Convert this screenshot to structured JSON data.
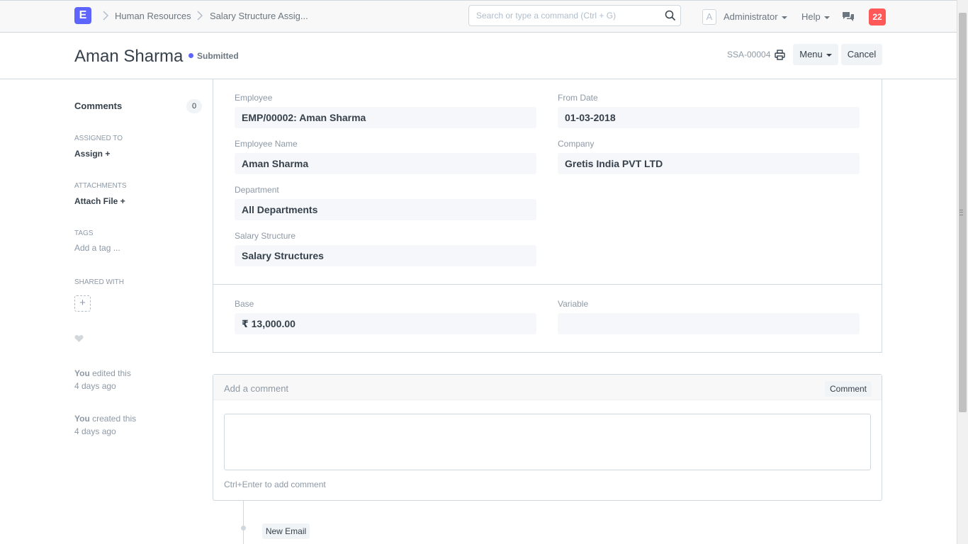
{
  "navbar": {
    "logo_letter": "E",
    "breadcrumbs": [
      "Human Resources",
      "Salary Structure Assig..."
    ],
    "search_placeholder": "Search or type a command (Ctrl + G)",
    "user_initial": "A",
    "user_label": "Administrator",
    "help_label": "Help",
    "notification_count": "22",
    "icons": [
      "chevron-right-icon",
      "search-icon",
      "caret-down-icon",
      "chat-icon"
    ]
  },
  "page": {
    "title": "Aman Sharma",
    "status": "Submitted",
    "status_color": "#5e64ff",
    "doc_id": "SSA-00004",
    "menu_label": "Menu",
    "cancel_label": "Cancel"
  },
  "sidebar": {
    "comments_label": "Comments",
    "comments_count": "0",
    "assigned_to_label": "ASSIGNED TO",
    "assign_label": "Assign",
    "attachments_label": "ATTACHMENTS",
    "attach_label": "Attach File",
    "tags_label": "TAGS",
    "add_tag_label": "Add a tag ...",
    "shared_with_label": "SHARED WITH",
    "activity": [
      {
        "actor": "You",
        "action": " edited this",
        "time": "4 days ago"
      },
      {
        "actor": "You",
        "action": " created this",
        "time": "4 days ago"
      }
    ]
  },
  "form": {
    "employee": {
      "label": "Employee",
      "value": "EMP/00002: Aman Sharma"
    },
    "from_date": {
      "label": "From Date",
      "value": "01-03-2018"
    },
    "employee_name": {
      "label": "Employee Name",
      "value": "Aman Sharma"
    },
    "company": {
      "label": "Company",
      "value": "Gretis India PVT LTD"
    },
    "department": {
      "label": "Department",
      "value": "All Departments"
    },
    "salary_structure": {
      "label": "Salary Structure",
      "value": "Salary Structures"
    },
    "base": {
      "label": "Base",
      "value": "₹ 13,000.00"
    },
    "variable": {
      "label": "Variable",
      "value": ""
    }
  },
  "comment": {
    "title": "Add a comment",
    "button_label": "Comment",
    "hint": "Ctrl+Enter to add comment"
  },
  "timeline": {
    "new_email_label": "New Email"
  }
}
